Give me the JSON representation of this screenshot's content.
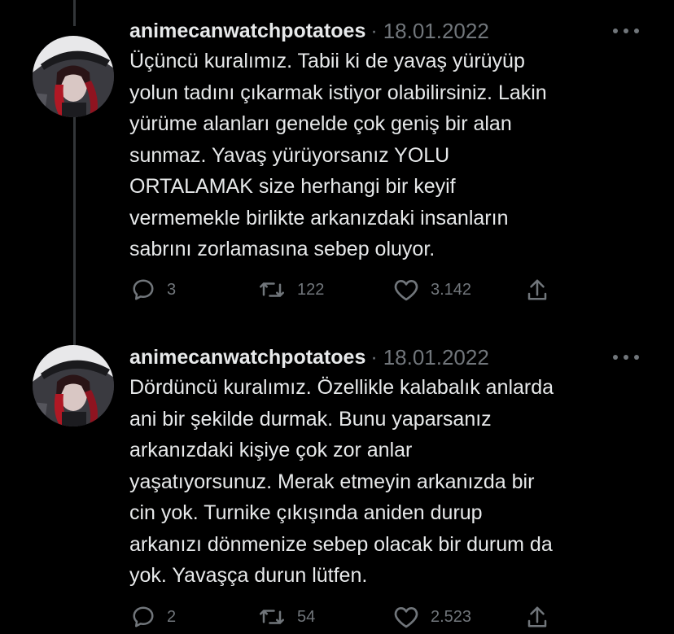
{
  "tweets": [
    {
      "username": "animecanwatchpotatoes",
      "separator": "·",
      "date": "18.01.2022",
      "text": "Üçüncü kuralımız. Tabii ki de yavaş yürüyüp\nyolun tadını çıkarmak istiyor olabilirsiniz. Lakin\nyürüme alanları genelde çok geniş bir alan\nsunmaz. Yavaş yürüyorsanız YOLU\nORTALAMAK size herhangi bir keyif\nvermemekle birlikte arkanızdaki insanların\nsabrını zorlamasına sebep oluyor.",
      "replies": "3",
      "retweets": "122",
      "likes": "3.142"
    },
    {
      "username": "animecanwatchpotatoes",
      "separator": "·",
      "date": "18.01.2022",
      "text": "Dördüncü kuralımız. Özellikle kalabalık anlarda\nani bir şekilde durmak. Bunu yaparsanız\narkanızdaki kişiye çok zor anlar\nyaşatıyorsunuz. Merak etmeyin arkanızda bir\ncin yok. Turnike çıkışında aniden durup\narkanızı dönmenize sebep olacak bir durum da\nyok. Yavaşça durun lütfen.",
      "replies": "2",
      "retweets": "54",
      "likes": "2.523"
    }
  ],
  "icons": {
    "reply": "reply-icon",
    "retweet": "retweet-icon",
    "like": "heart-icon",
    "share": "share-icon",
    "more": "more-options-icon",
    "avatar": "anime-avatar"
  },
  "colors": {
    "background": "#000000",
    "text": "#e7e9ea",
    "secondary": "#71767b",
    "thread_line": "#333639"
  }
}
